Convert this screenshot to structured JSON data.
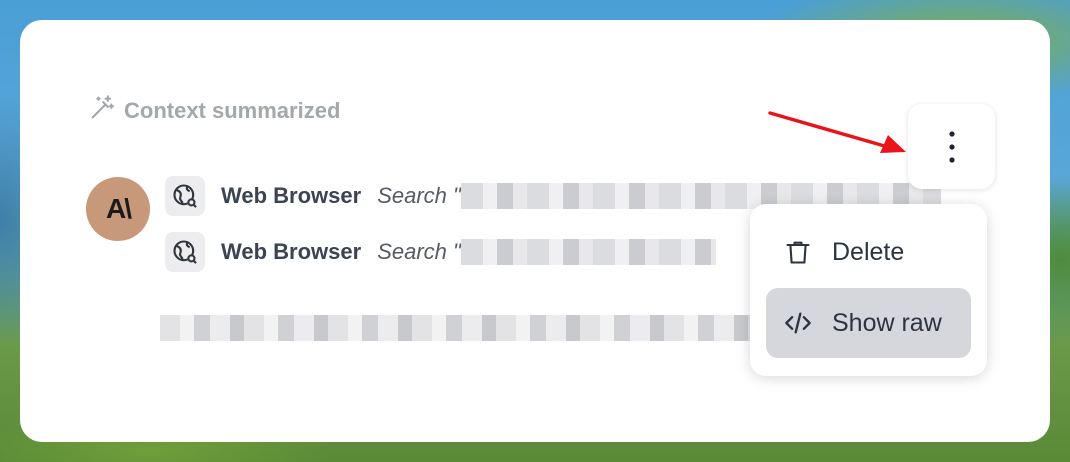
{
  "context_label": "Context summarized",
  "avatar": {
    "text": "A\\",
    "color": "#c8987a"
  },
  "tool_calls": [
    {
      "name": "Web Browser",
      "query": "Search \""
    },
    {
      "name": "Web Browser",
      "query": "Search \""
    }
  ],
  "menu": {
    "items": [
      {
        "label": "Delete",
        "icon": "trash-icon"
      },
      {
        "label": "Show raw",
        "icon": "code-icon"
      }
    ]
  },
  "colors": {
    "arrow": "#e8141a",
    "highlight": "#d6d7dc",
    "muted": "#a3a7ae"
  }
}
